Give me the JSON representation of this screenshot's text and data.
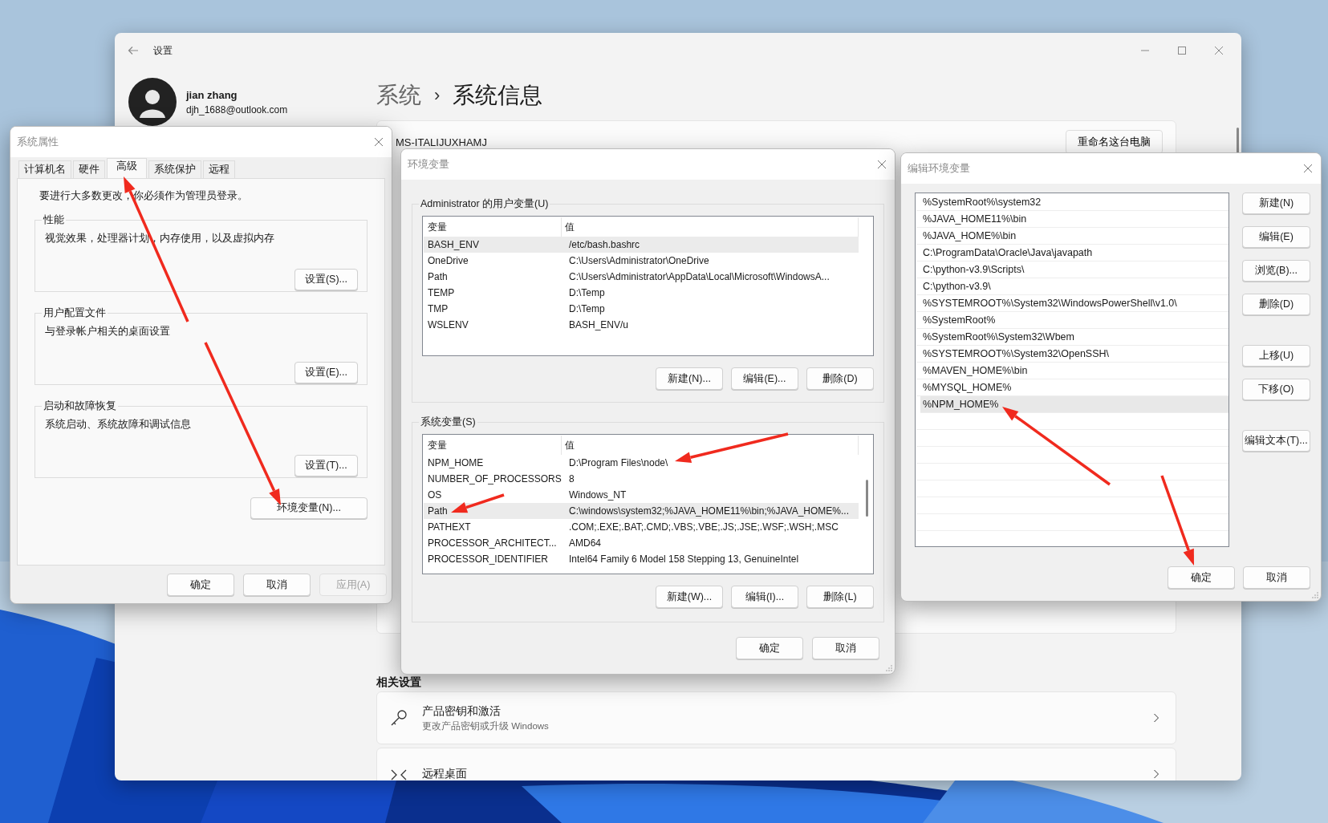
{
  "settings_window": {
    "title": "设置",
    "user": {
      "name": "jian zhang",
      "email": "djh_1688@outlook.com"
    },
    "breadcrumb": [
      "系统",
      "系统信息"
    ],
    "breadcrumb_separator": "›",
    "device_name": "MS-ITALIJUXHAMJ",
    "rename_button": "重命名这台电脑",
    "related_heading": "相关设置",
    "related_items": [
      {
        "kind": "key",
        "title": "产品密钥和激活",
        "subtitle": "更改产品密钥或升级 Windows"
      },
      {
        "kind": "remote",
        "title": "远程桌面"
      }
    ]
  },
  "system_properties": {
    "title": "系统属性",
    "tabs": [
      {
        "label": "计算机名",
        "selected": false
      },
      {
        "label": "硬件",
        "selected": false
      },
      {
        "label": "高级",
        "selected": true
      },
      {
        "label": "系统保护",
        "selected": false
      },
      {
        "label": "远程",
        "selected": false
      }
    ],
    "notice": "要进行大多数更改，你必须作为管理员登录。",
    "groups": [
      {
        "title": "性能",
        "description": "视觉效果，处理器计划，内存使用，以及虚拟内存",
        "button": "设置(S)..."
      },
      {
        "title": "用户配置文件",
        "description": "与登录帐户相关的桌面设置",
        "button": "设置(E)..."
      },
      {
        "title": "启动和故障恢复",
        "description": "系统启动、系统故障和调试信息",
        "button": "设置(T)..."
      }
    ],
    "env_button": "环境变量(N)...",
    "buttons": [
      {
        "label": "确定",
        "disabled": false
      },
      {
        "label": "取消",
        "disabled": false
      },
      {
        "label": "应用(A)",
        "disabled": true
      }
    ]
  },
  "environment_variables": {
    "title": "环境变量",
    "user_vars": {
      "title": "Administrator 的用户变量(U)",
      "columns": [
        "变量",
        "值"
      ],
      "rows": [
        {
          "name": "BASH_ENV",
          "value": "/etc/bash.bashrc",
          "selected": true
        },
        {
          "name": "OneDrive",
          "value": "C:\\Users\\Administrator\\OneDrive",
          "selected": false
        },
        {
          "name": "Path",
          "value": "C:\\Users\\Administrator\\AppData\\Local\\Microsoft\\WindowsA...",
          "selected": false
        },
        {
          "name": "TEMP",
          "value": "D:\\Temp",
          "selected": false
        },
        {
          "name": "TMP",
          "value": "D:\\Temp",
          "selected": false
        },
        {
          "name": "WSLENV",
          "value": "BASH_ENV/u",
          "selected": false
        }
      ],
      "buttons": [
        "新建(N)...",
        "编辑(E)...",
        "删除(D)"
      ]
    },
    "system_vars": {
      "title": "系统变量(S)",
      "columns": [
        "变量",
        "值"
      ],
      "rows": [
        {
          "name": "NPM_HOME",
          "value": "D:\\Program Files\\node\\",
          "selected": false
        },
        {
          "name": "NUMBER_OF_PROCESSORS",
          "value": "8",
          "selected": false
        },
        {
          "name": "OS",
          "value": "Windows_NT",
          "selected": false
        },
        {
          "name": "Path",
          "value": "C:\\windows\\system32;%JAVA_HOME11%\\bin;%JAVA_HOME%...",
          "selected": true
        },
        {
          "name": "PATHEXT",
          "value": ".COM;.EXE;.BAT;.CMD;.VBS;.VBE;.JS;.JSE;.WSF;.WSH;.MSC",
          "selected": false
        },
        {
          "name": "PROCESSOR_ARCHITECT...",
          "value": "AMD64",
          "selected": false
        },
        {
          "name": "PROCESSOR_IDENTIFIER",
          "value": "Intel64 Family 6 Model 158 Stepping 13, GenuineIntel",
          "selected": false
        }
      ],
      "buttons": [
        "新建(W)...",
        "编辑(I)...",
        "删除(L)"
      ]
    },
    "buttons": [
      "确定",
      "取消"
    ]
  },
  "edit_env_var": {
    "title": "编辑环境变量",
    "entries": [
      {
        "text": "%SystemRoot%\\system32",
        "selected": false
      },
      {
        "text": "%JAVA_HOME11%\\bin",
        "selected": false
      },
      {
        "text": "%JAVA_HOME%\\bin",
        "selected": false
      },
      {
        "text": "C:\\ProgramData\\Oracle\\Java\\javapath",
        "selected": false
      },
      {
        "text": "C:\\python-v3.9\\Scripts\\",
        "selected": false
      },
      {
        "text": "C:\\python-v3.9\\",
        "selected": false
      },
      {
        "text": "%SYSTEMROOT%\\System32\\WindowsPowerShell\\v1.0\\",
        "selected": false
      },
      {
        "text": "%SystemRoot%",
        "selected": false
      },
      {
        "text": "%SystemRoot%\\System32\\Wbem",
        "selected": false
      },
      {
        "text": "%SYSTEMROOT%\\System32\\OpenSSH\\",
        "selected": false
      },
      {
        "text": "%MAVEN_HOME%\\bin",
        "selected": false
      },
      {
        "text": "%MYSQL_HOME%",
        "selected": false
      },
      {
        "text": "%NPM_HOME%",
        "selected": true
      }
    ],
    "side_buttons": [
      "新建(N)",
      "编辑(E)",
      "浏览(B)...",
      "删除(D)",
      "上移(U)",
      "下移(O)",
      "编辑文本(T)..."
    ],
    "buttons": [
      "确定",
      "取消"
    ]
  },
  "annotation_arrows": [
    {
      "color": "#f02a1e"
    },
    {
      "color": "#f02a1e"
    },
    {
      "color": "#f02a1e"
    },
    {
      "color": "#f02a1e"
    },
    {
      "color": "#f02a1e"
    },
    {
      "color": "#f02a1e"
    }
  ]
}
